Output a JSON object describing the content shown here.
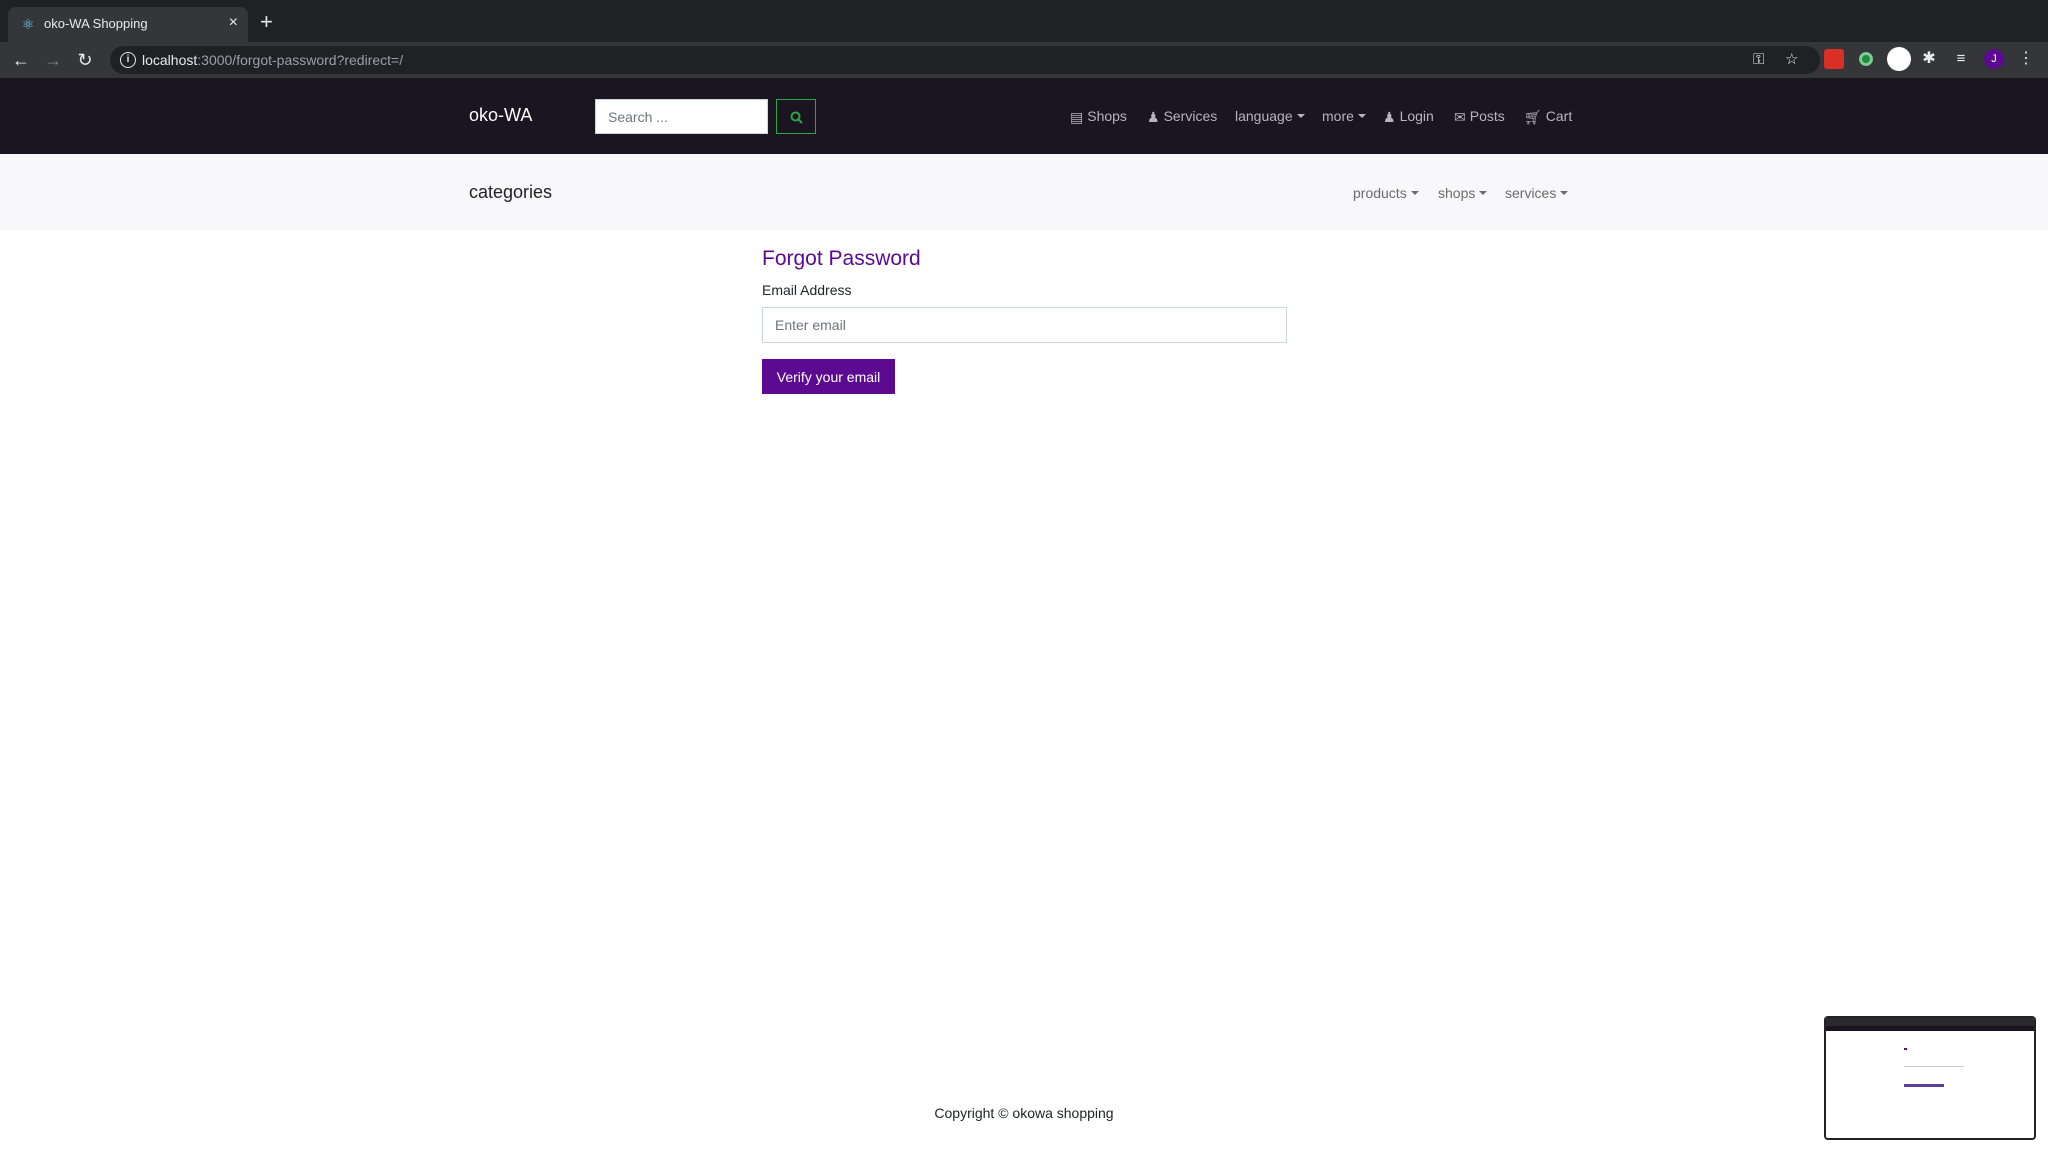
{
  "browser": {
    "tab_title": "oko-WA Shopping",
    "tab_close": "×",
    "new_tab": "+",
    "url_host": "localhost",
    "url_rest": ":3000/forgot-password?redirect=/",
    "profile_initial": "J"
  },
  "header": {
    "brand": "oko-WA",
    "search_placeholder": "Search ...",
    "nav": {
      "shops": "Shops",
      "services": "Services",
      "language": "language",
      "more": "more",
      "login": "Login",
      "posts": "Posts",
      "cart": "Cart"
    }
  },
  "categories_bar": {
    "title": "categories",
    "links": {
      "products": "products",
      "shops": "shops",
      "services": "services"
    }
  },
  "form": {
    "title": "Forgot Password",
    "email_label": "Email Address",
    "email_placeholder": "Enter email",
    "submit_label": "Verify your email"
  },
  "footer": {
    "copyright": "Copyright © okowa shopping"
  },
  "colors": {
    "accent": "#5b0a91",
    "header_bg": "#1b1522",
    "search_button_border": "#28a745"
  }
}
